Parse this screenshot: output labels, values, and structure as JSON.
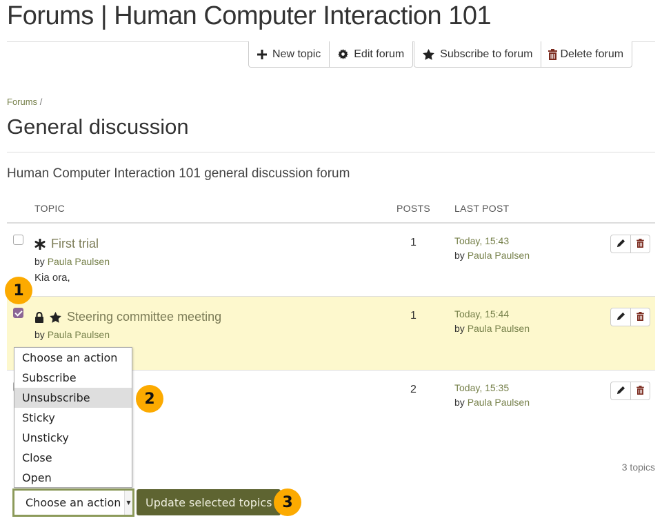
{
  "page": {
    "title": "Forums | Human Computer Interaction 101"
  },
  "toolbar": {
    "new_topic": {
      "label": "New topic",
      "icon": "plus-icon"
    },
    "edit_forum": {
      "label": "Edit forum",
      "icon": "gear-icon"
    },
    "subscribe": {
      "label": "Subscribe to forum",
      "icon": "star-icon"
    },
    "delete_forum": {
      "label": "Delete forum",
      "icon": "trash-icon"
    }
  },
  "breadcrumb": {
    "root": "Forums",
    "separator": "/"
  },
  "forum": {
    "title": "General discussion",
    "description": "Human Computer Interaction 101 general discussion forum"
  },
  "table": {
    "headers": {
      "topic": "TOPIC",
      "posts": "POSTS",
      "last_post": "LAST POST"
    },
    "rows": [
      {
        "title": "First trial",
        "icons": [
          "asterisk-icon"
        ],
        "by_prefix": "by",
        "author": "Paula Paulsen",
        "excerpt": "Kia ora,",
        "posts": "1",
        "last_post_date": "Today, 15:43",
        "last_post_by_prefix": "by",
        "last_post_author": "Paula Paulsen",
        "checked": false,
        "selected": false
      },
      {
        "title": "Steering committee meeting",
        "icons": [
          "lock-icon",
          "star-icon"
        ],
        "by_prefix": "by",
        "author": "Paula Paulsen",
        "excerpt": "",
        "posts": "1",
        "last_post_date": "Today, 15:44",
        "last_post_by_prefix": "by",
        "last_post_author": "Paula Paulsen",
        "checked": true,
        "selected": true
      },
      {
        "title": "",
        "icons": [],
        "by_prefix": "",
        "author": "",
        "excerpt": "",
        "posts": "2",
        "last_post_date": "Today, 15:35",
        "last_post_by_prefix": "by",
        "last_post_author": "Paula Paulsen",
        "checked": false,
        "selected": false
      }
    ]
  },
  "topic_count": "3 topics",
  "actions": {
    "select_value": "Choose an action",
    "options": [
      "Choose an action",
      "Subscribe",
      "Unsubscribe",
      "Sticky",
      "Unsticky",
      "Close",
      "Open"
    ],
    "highlighted_option": "Unsubscribe",
    "update_button": "Update selected topics"
  },
  "callouts": [
    "1",
    "2",
    "3"
  ],
  "colors": {
    "accent_link": "#76804a",
    "selected_row_bg": "#fdf8cd",
    "checkbox_checked": "#8c6695",
    "primary_button": "#5e6431",
    "callout": "#fcaa00",
    "delete_icon": "#7a2a1e"
  }
}
